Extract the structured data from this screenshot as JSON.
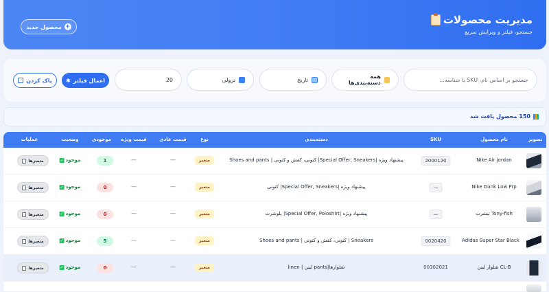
{
  "header": {
    "title": "مدیریت محصولات",
    "subtitle": "جستجو، فیلتر و ویرایش سریع",
    "new_product_label": "محصول جدید",
    "accent": "#3f7bf3"
  },
  "filters": {
    "search_placeholder": "جستجو بر اساس نام، SKU یا شناسه...",
    "category_label": "همه دسته‌بندی‌ها",
    "date_label": "تاریخ",
    "sort_label": "نزولی",
    "per_page_value": "20",
    "apply_label": "اعمال فیلتر",
    "clear_label": "پاک کردن"
  },
  "results": {
    "count_text": "150 محصول یافت شد"
  },
  "table": {
    "headers": {
      "image": "تصویر",
      "name": "نام محصول",
      "sku": "SKU",
      "categories": "دسته‌بندی",
      "type": "نوع",
      "regular_price": "قیمت عادی",
      "sale_price": "قیمت ویژه",
      "stock": "موجودی",
      "status": "وضعیت",
      "actions": "عملیات"
    },
    "rows": [
      {
        "name": "Nike Air jordan",
        "sku": "2000120",
        "categories": "پیشنهاد ویژه |Special Offer, Sneakers| کتونی، کفش و کتونی | Shoes and pants",
        "type": "متغیر",
        "regular": "—",
        "sale": "—",
        "stock": "1",
        "status": "موجود",
        "action": "متغیرها"
      },
      {
        "name": "Nike Dunk Low Prp",
        "sku": "—",
        "categories": "پیشنهاد ویژه |Special Offer, Sneakers| کتونی",
        "type": "متغیر",
        "regular": "—",
        "sale": "—",
        "stock": "0",
        "status": "موجود",
        "action": "متغیرها"
      },
      {
        "name": "تیشرت Tony-fish",
        "sku": "—",
        "categories": "پیشنهاد ویژه |Special Offer, Poloshirt| پلوشرت",
        "type": "متغیر",
        "regular": "—",
        "sale": "—",
        "stock": "0",
        "status": "موجود",
        "action": "متغیرها"
      },
      {
        "name": "Adidas Super Star Black",
        "sku": "0020420",
        "categories": "Sneakers | کتونی، کفش و کتونی | Shoes and pants",
        "type": "متغیر",
        "regular": "—",
        "sale": "—",
        "stock": "5",
        "status": "موجود",
        "action": "متغیرها"
      },
      {
        "name": "شلوار لینن CL-B",
        "sku": "00302021",
        "categories": "شلوارها|pants لینن | linen",
        "type": "متغیر",
        "regular": "—",
        "sale": "—",
        "stock": "0",
        "status": "موجود",
        "action": "متغیرها"
      }
    ]
  }
}
